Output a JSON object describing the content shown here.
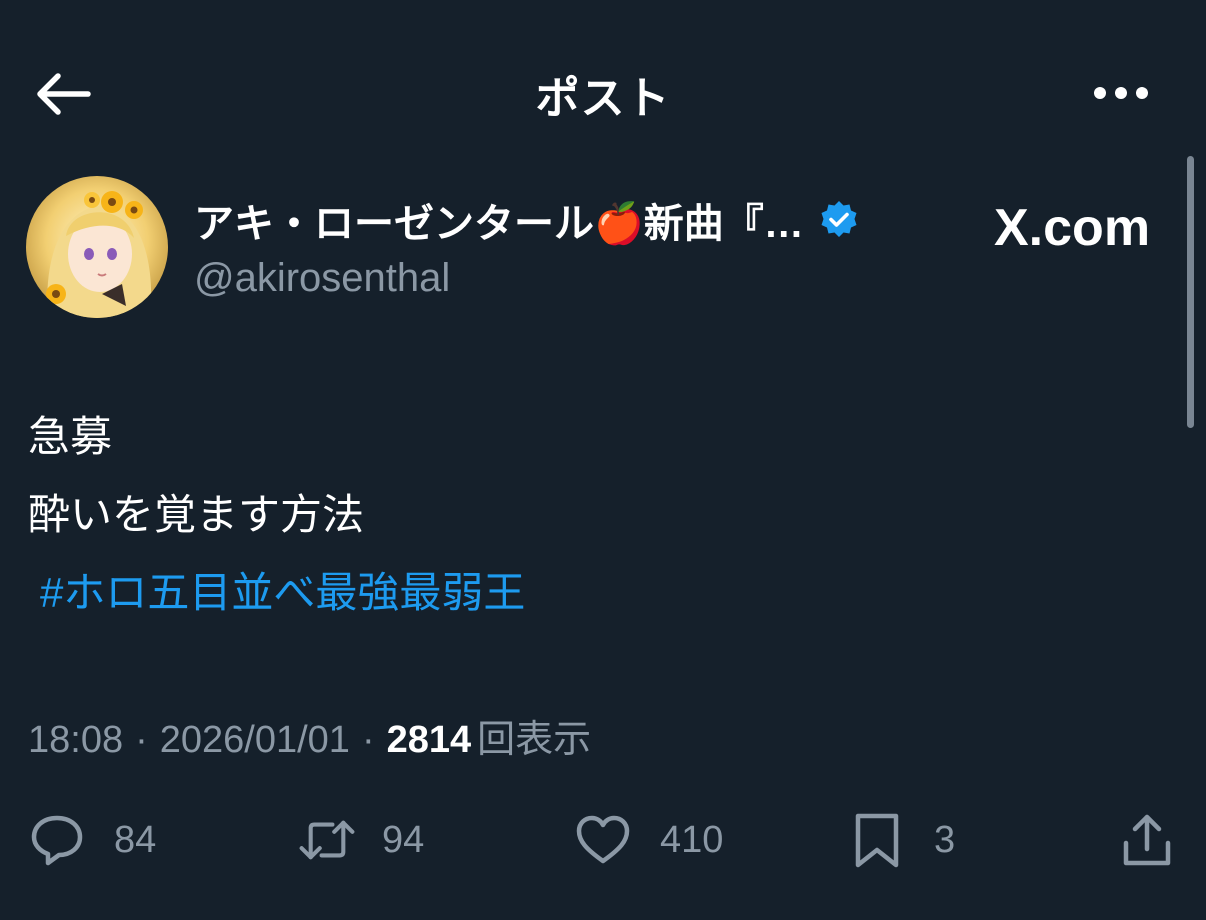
{
  "header": {
    "title": "ポスト",
    "back_icon": "arrow-left-icon",
    "more_icon": "more-horizontal-icon"
  },
  "author": {
    "display_name": "アキ・ローゼンタール🍎新曲『…",
    "handle": "@akirosenthal",
    "verified_color": "#1d9bf0",
    "watermark": "X.com"
  },
  "tweet": {
    "lines": [
      "急募",
      "酔いを覚ます方法"
    ],
    "hashtag": "#ホロ五目並べ最強最弱王"
  },
  "meta": {
    "time": "18:08",
    "date": "2026/01/01",
    "views_count": "2814",
    "views_label": "回表示"
  },
  "actions": {
    "replies": "84",
    "reposts": "94",
    "likes": "410",
    "bookmarks": "3"
  },
  "colors": {
    "background": "#15202b",
    "text": "#ffffff",
    "secondary": "#8b98a5",
    "accent": "#1d9bf0"
  }
}
